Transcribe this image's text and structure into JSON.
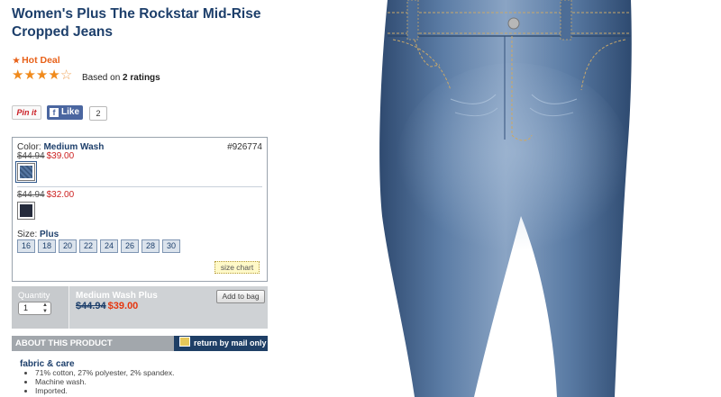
{
  "product": {
    "title": "Women's Plus The Rockstar Mid-Rise Cropped Jeans",
    "hot_deal": "Hot Deal",
    "rating": {
      "filled": 4,
      "total": 5,
      "based_on_text": "Based on ",
      "count_text": "2 ratings"
    }
  },
  "social": {
    "pinit": "Pin it",
    "like": "Like",
    "like_count": "2"
  },
  "options": {
    "color_label": "Color: ",
    "color_value": "Medium Wash",
    "sku": "#926774",
    "swatches": [
      {
        "orig_price": "$44.94",
        "sale_price": "$39.00",
        "color": "#41618d",
        "selected": true
      },
      {
        "orig_price": "$44.94",
        "sale_price": "$32.00",
        "color": "#252b3c",
        "selected": false
      }
    ],
    "size_label": "Size: ",
    "size_value": "Plus",
    "sizes": [
      "16",
      "18",
      "20",
      "22",
      "24",
      "26",
      "28",
      "30"
    ],
    "size_chart": "size chart"
  },
  "bag": {
    "quantity_label": "Quantity",
    "quantity_value": "1",
    "selection_name": "Medium Wash Plus",
    "orig_price": "$44.94",
    "sale_price": "$39.00",
    "add_button": "Add to bag"
  },
  "about": {
    "title": "ABOUT THIS PRODUCT",
    "return_label": "return by mail only",
    "fabric_heading": "fabric & care",
    "fabric_items": [
      "71% cotton, 27% polyester, 2% spandex.",
      "Machine wash.",
      "Imported."
    ]
  },
  "colors": {
    "title": "#1d3f6b",
    "hot_deal": "#e8621a",
    "star": "#f08a1c",
    "sale": "#cc1f1f",
    "denim": "#4b6b95"
  }
}
